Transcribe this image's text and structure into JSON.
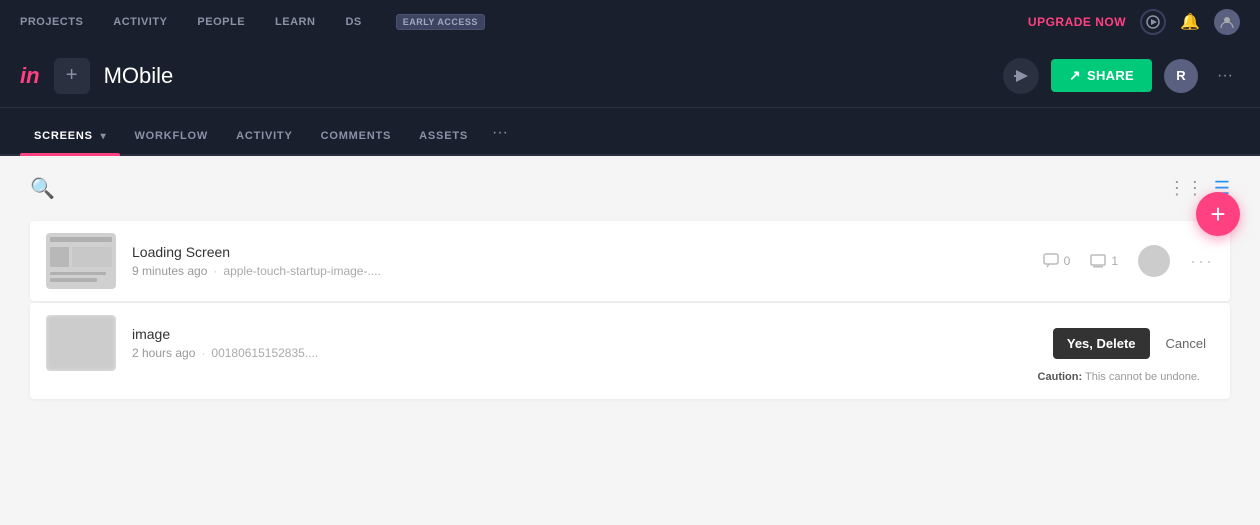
{
  "topNav": {
    "items": [
      "PROJECTS",
      "ACTIVITY",
      "PEOPLE",
      "LEARN"
    ],
    "dsLabel": "DS",
    "earlyAccessLabel": "EARLY ACCESS",
    "upgradeNow": "UPGRADE NOW"
  },
  "projectHeader": {
    "logo": "in",
    "addLabel": "+",
    "title": "MObile",
    "shareLabel": "SHARE",
    "avatarLabel": "R",
    "moreLabel": "···"
  },
  "tabs": {
    "items": [
      "SCREENS",
      "WORKFLOW",
      "ACTIVITY",
      "COMMENTS",
      "ASSETS"
    ],
    "activeIndex": 0,
    "moreLabel": "···"
  },
  "screens": [
    {
      "name": "Loading Screen",
      "time": "9 minutes ago",
      "filename": "apple-touch-startup-image-....",
      "comments": "0",
      "previews": "1"
    },
    {
      "name": "image",
      "time": "2 hours ago",
      "filename": "00180615152835...."
    }
  ],
  "deleteConfirm": {
    "yesDelete": "Yes, Delete",
    "cancel": "Cancel",
    "caution": "Caution:",
    "cautionText": "This cannot be undone."
  },
  "fab": "+",
  "toolbar": {
    "searchPlaceholder": "Search"
  }
}
